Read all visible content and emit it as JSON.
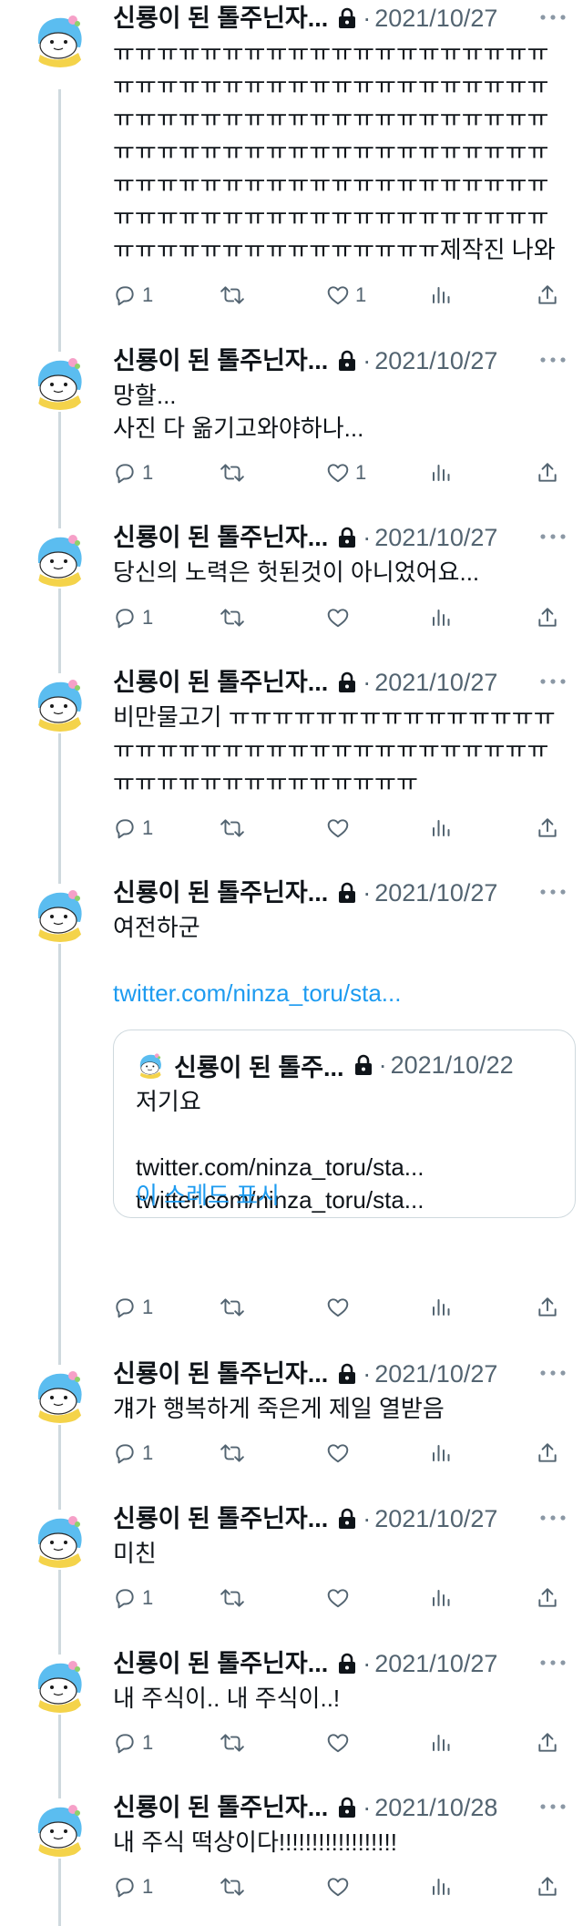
{
  "author": {
    "name": "신룡이 된 톨주닌자...",
    "avatar_icon": "shark-mascot-avatar",
    "lock_icon": "lock-icon"
  },
  "colors": {
    "text": "#0f1419",
    "secondary": "#536471",
    "link": "#1d9bf0",
    "thread_line": "#cfd9de",
    "avatar_body": "#5bbdf0",
    "avatar_scarf": "#f4d34a"
  },
  "tweets": [
    {
      "date": "2021/10/27",
      "text": "ㅠㅠㅠㅠㅠㅠㅠㅠㅠㅠㅠㅠㅠㅠㅠㅠㅠㅠㅠㅠㅠㅠㅠㅠㅠㅠㅠㅠㅠㅠㅠㅠㅠㅠㅠㅠㅠㅠㅠㅠㅠㅠㅠㅠㅠㅠㅠㅠㅠㅠㅠㅠㅠㅠㅠㅠㅠㅠㅠㅠㅠㅠㅠㅠㅠㅠㅠㅠㅠㅠㅠㅠㅠㅠㅠㅠㅠㅠㅠㅠㅠㅠㅠㅠㅠㅠㅠㅠㅠㅠㅠㅠㅠㅠㅠㅠㅠㅠㅠㅠㅠㅠㅠㅠㅠㅠㅠㅠㅠㅠㅠㅠㅠㅠㅠㅠㅠㅠㅠㅠㅠㅠㅠㅠㅠㅠㅠㅠㅠㅠㅠㅠㅠㅠㅠ제작진 나와 ㅠㅠㅠㅠㅠㅠㅠㅠㅠㅠㅠ",
      "replies": "1",
      "retweets": "",
      "likes": "1"
    },
    {
      "date": "2021/10/27",
      "text": "망할...\n사진 다 옮기고와야하나...",
      "replies": "1",
      "retweets": "",
      "likes": "1"
    },
    {
      "date": "2021/10/27",
      "text": "당신의 노력은 헛된것이 아니었어요...",
      "replies": "1",
      "retweets": "",
      "likes": ""
    },
    {
      "date": "2021/10/27",
      "text": "비만물고기 ㅠㅠㅠㅠㅠㅠㅠㅠㅠㅠㅠㅠㅠㅠㅠㅠㅠㅠㅠㅠㅠㅠㅠㅠㅠㅠㅠㅠㅠㅠㅠㅠㅠㅠㅠㅠㅠㅠㅠㅠㅠㅠㅠㅠㅠㅠㅠㅠㅠ",
      "replies": "1",
      "retweets": "",
      "likes": ""
    },
    {
      "date": "2021/10/27",
      "text": "여전하군",
      "link": "twitter.com/ninza_toru/sta...",
      "replies": "1",
      "retweets": "",
      "likes": "",
      "quote": {
        "name": "신룡이 된 톨주...",
        "date": "2021/10/22",
        "text": "저기요\n\ntwitter.com/ninza_toru/sta...\ntwitter.com/ninza_toru/sta...",
        "show_thread": "이 스레드 표시"
      }
    },
    {
      "date": "2021/10/27",
      "text": "걔가 행복하게 죽은게 제일 열받음",
      "replies": "1",
      "retweets": "",
      "likes": ""
    },
    {
      "date": "2021/10/27",
      "text": "미친",
      "replies": "1",
      "retweets": "",
      "likes": ""
    },
    {
      "date": "2021/10/27",
      "text": "내 주식이.. 내 주식이..!",
      "replies": "1",
      "retweets": "",
      "likes": ""
    },
    {
      "date": "2021/10/28",
      "text": "내 주식 떡상이다!!!!!!!!!!!!!!!!!!",
      "replies": "1",
      "retweets": "",
      "likes": ""
    }
  ]
}
